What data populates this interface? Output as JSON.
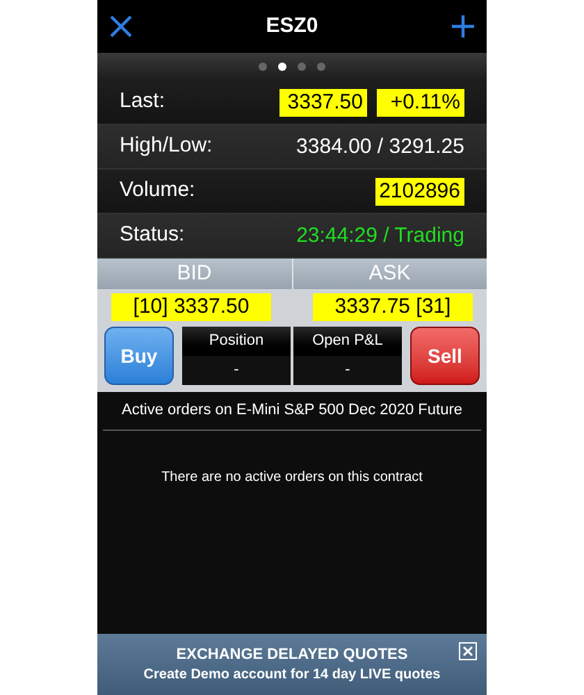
{
  "header": {
    "title": "ESZ0"
  },
  "pager": [
    {
      "selected": false
    },
    {
      "selected": true
    },
    {
      "selected": false
    },
    {
      "selected": false
    }
  ],
  "quote_rows": [
    {
      "label": "Last:",
      "values": [
        {
          "text": "3337.50",
          "highlighted": true
        },
        {
          "text": "+0.11%",
          "highlighted": true
        }
      ]
    },
    {
      "label": "High/Low:",
      "values": [
        {
          "text": "3384.00 / 3291.25",
          "highlighted": false
        }
      ]
    },
    {
      "label": "Volume:",
      "values": [
        {
          "text": "2102896",
          "highlighted": true
        }
      ]
    },
    {
      "label": "Status:",
      "values": [
        {
          "text": "23:44:29 / Trading",
          "highlighted": false,
          "color": "#22dd22"
        }
      ]
    }
  ],
  "bid": {
    "label": "BID",
    "value": "[10] 3337.50"
  },
  "ask": {
    "label": "ASK",
    "value": "3337.75 [31]"
  },
  "buy_button": "Buy",
  "sell_button": "Sell",
  "position": {
    "label": "Position",
    "value": "-"
  },
  "open_pnl": {
    "label": "Open P&L",
    "value": "-"
  },
  "orders_title": "Active orders on E-Mini S&P 500 Dec 2020 Future",
  "orders_empty": "There are no active orders on this contract",
  "banner": {
    "title": "EXCHANGE DELAYED QUOTES",
    "subtitle": "Create Demo account for 14 day LIVE quotes"
  }
}
